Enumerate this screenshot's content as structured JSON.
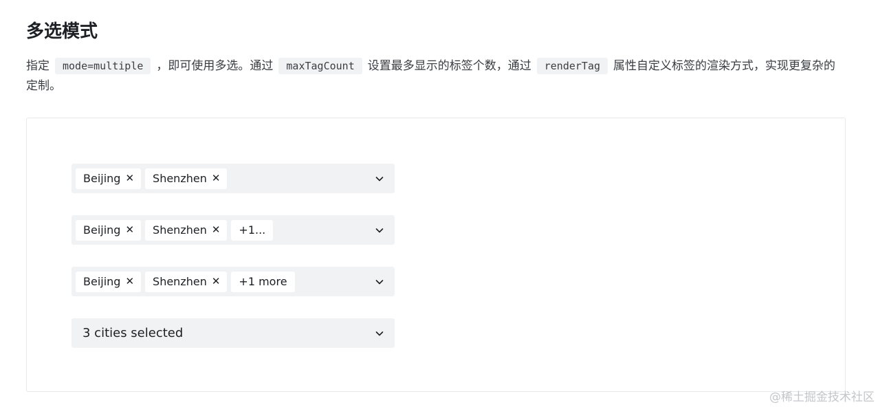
{
  "section": {
    "title": "多选模式"
  },
  "description": {
    "part1": "指定",
    "code1": "mode=multiple",
    "part2": "，即可使用多选。通过",
    "code2": "maxTagCount",
    "part3": "设置最多显示的标签个数，通过",
    "code3": "renderTag",
    "part4": "属性自定义标签的渲染方式，实现更复杂的定制。"
  },
  "selects": [
    {
      "tags": [
        "Beijing",
        "Shenzhen"
      ]
    },
    {
      "tags": [
        "Beijing",
        "Shenzhen"
      ],
      "more": "+1..."
    },
    {
      "tags": [
        "Beijing",
        "Shenzhen"
      ],
      "more": "+1 more"
    },
    {
      "summary": "3 cities selected"
    }
  ],
  "icons": {
    "tag_close": "close-icon",
    "dropdown": "chevron-down-icon"
  },
  "watermark": "@稀土掘金技术社区"
}
